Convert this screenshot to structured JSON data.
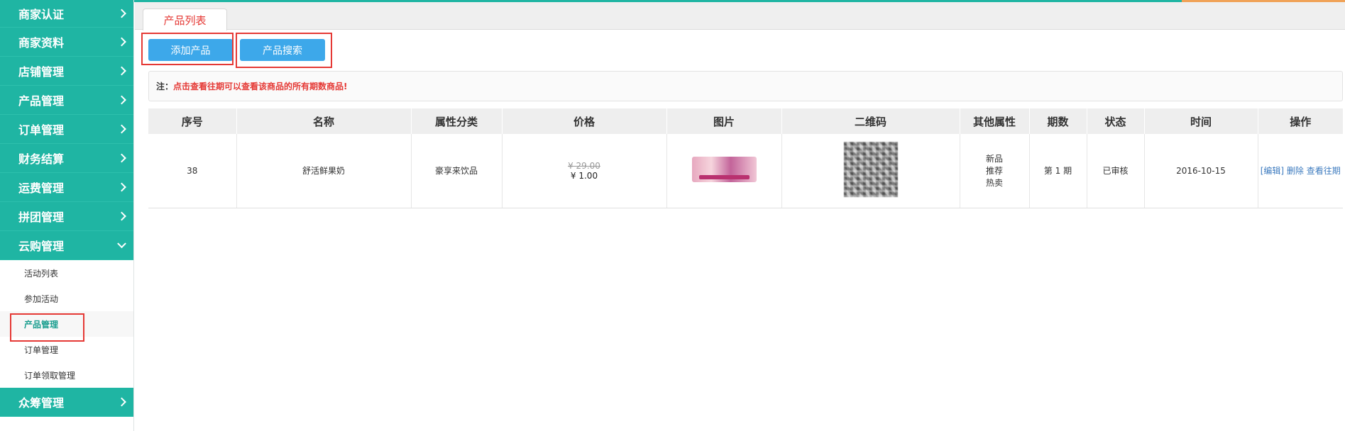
{
  "sidebar": {
    "menu": [
      {
        "label": "商家认证"
      },
      {
        "label": "商家资料"
      },
      {
        "label": "店铺管理"
      },
      {
        "label": "产品管理"
      },
      {
        "label": "订单管理"
      },
      {
        "label": "财务结算"
      },
      {
        "label": "运费管理"
      },
      {
        "label": "拼团管理"
      },
      {
        "label": "云购管理",
        "expanded": true
      }
    ],
    "submenu": [
      {
        "label": "活动列表"
      },
      {
        "label": "参加活动"
      },
      {
        "label": "产品管理",
        "active": true
      },
      {
        "label": "订单管理"
      },
      {
        "label": "订单领取管理"
      }
    ],
    "last_menu": {
      "label": "众筹管理"
    }
  },
  "tab": {
    "label": "产品列表"
  },
  "toolbar": {
    "add_label": "添加产品",
    "search_label": "产品搜索"
  },
  "notice": {
    "label": "注：",
    "text": "点击查看往期可以查看该商品的所有期数商品!"
  },
  "table": {
    "headers": [
      "序号",
      "名称",
      "属性分类",
      "价格",
      "图片",
      "二维码",
      "其他属性",
      "期数",
      "状态",
      "时间",
      "操作"
    ],
    "rows": [
      {
        "id": "38",
        "name": "舒活鲜果奶",
        "category": "豪享来饮品",
        "price_old": "¥ 29.00",
        "price_new": "¥ 1.00",
        "attrs": [
          "新品",
          "推荐",
          "热卖"
        ],
        "period": "第 1 期",
        "status": "已审核",
        "time": "2016-10-15",
        "actions": [
          "[编辑]",
          "删除",
          "查看往期"
        ]
      }
    ]
  },
  "colors": {
    "primary": "#1fb5a3",
    "button": "#3da8ea",
    "highlight": "#e53935"
  }
}
